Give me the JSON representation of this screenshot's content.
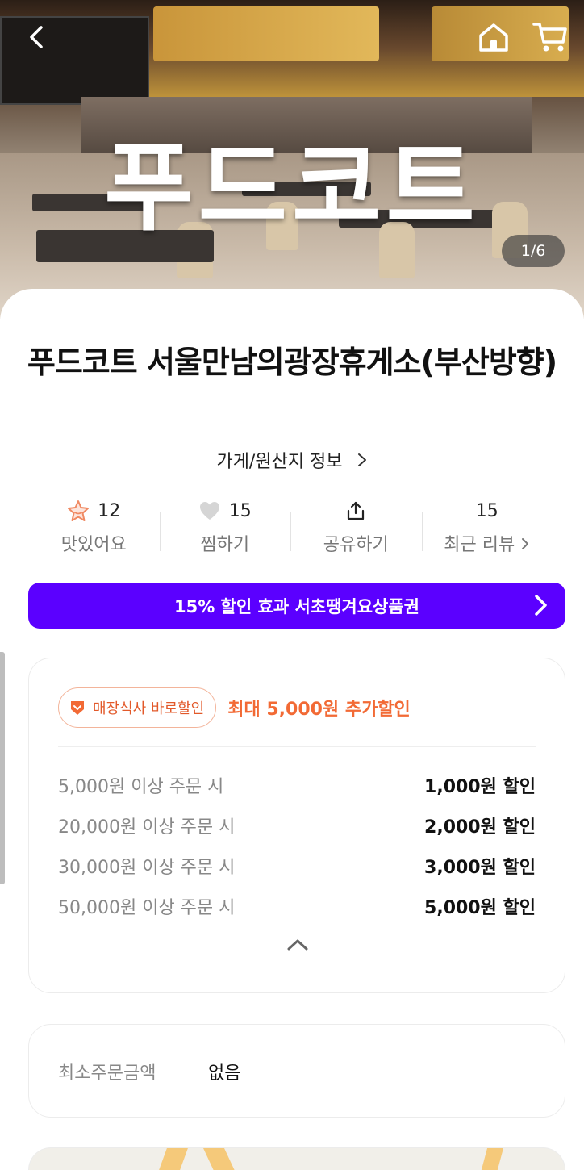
{
  "hero": {
    "title": "푸드코트",
    "page_indicator": "1/6"
  },
  "header": {
    "back_icon": "chevron-left-icon",
    "home_icon": "home-icon",
    "cart_icon": "cart-icon"
  },
  "store": {
    "name": "푸드코트 서울만남의광장휴게소(부산방향)",
    "info_link": "가게/원산지 정보"
  },
  "stats": [
    {
      "icon": "star-icon",
      "value": "12",
      "label": "맛있어요"
    },
    {
      "icon": "heart-icon",
      "value": "15",
      "label": "찜하기"
    },
    {
      "icon": "share-icon",
      "value": "",
      "label": "공유하기"
    },
    {
      "icon": "",
      "value": "15",
      "label": "최근 리뷰"
    }
  ],
  "promo": {
    "text": "15% 할인 효과 서초땡겨요상품권"
  },
  "discount": {
    "badge": "매장식사 바로할인",
    "headline": "최대 5,000원 추가할인",
    "tiers": [
      {
        "condition": "5,000원 이상 주문 시",
        "discount": "1,000원 할인"
      },
      {
        "condition": "20,000원 이상 주문 시",
        "discount": "2,000원 할인"
      },
      {
        "condition": "30,000원 이상 주문 시",
        "discount": "3,000원 할인"
      },
      {
        "condition": "50,000원 이상 주문 시",
        "discount": "5,000원 할인"
      }
    ]
  },
  "min_order": {
    "label": "최소주문금액",
    "value": "없음"
  },
  "colors": {
    "promo": "#5b00ff",
    "accent": "#f26a35"
  }
}
